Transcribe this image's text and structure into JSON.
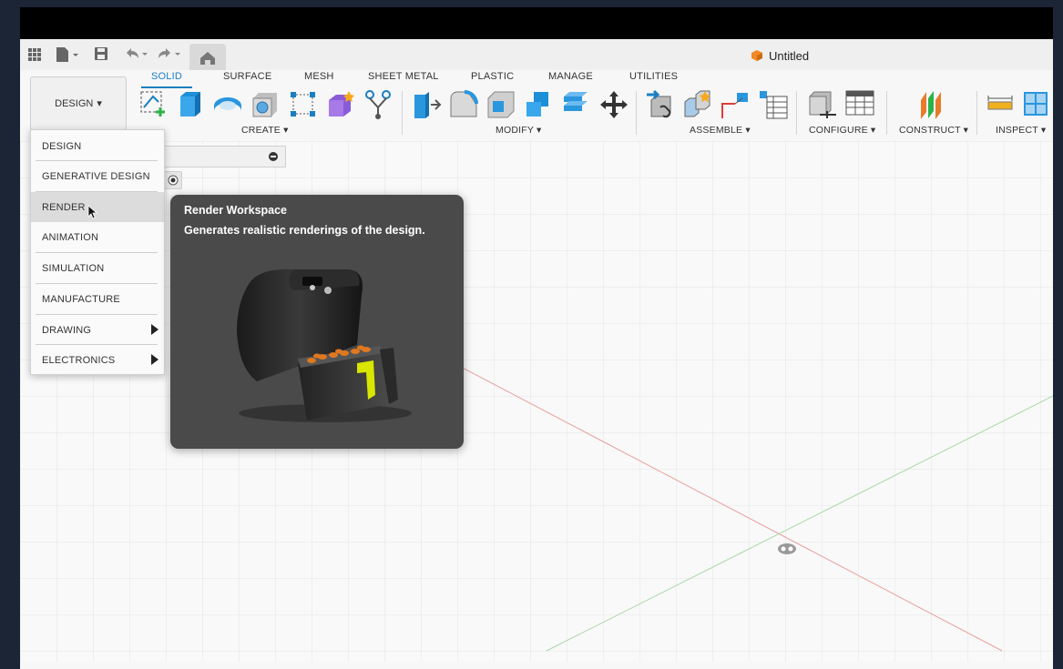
{
  "app": {
    "doc_title": "Untitled"
  },
  "toolbar": {
    "workspace_button": "DESIGN",
    "tabs": [
      "SOLID",
      "SURFACE",
      "MESH",
      "SHEET METAL",
      "PLASTIC",
      "MANAGE",
      "UTILITIES"
    ],
    "active_tab": "SOLID",
    "groups": [
      "CREATE ▾",
      "MODIFY ▾",
      "ASSEMBLE ▾",
      "CONFIGURE ▾",
      "CONSTRUCT ▾",
      "INSPECT ▾"
    ]
  },
  "workspace_menu": {
    "items": [
      "DESIGN",
      "GENERATIVE DESIGN",
      "RENDER",
      "ANIMATION",
      "SIMULATION",
      "MANUFACTURE",
      "DRAWING",
      "ELECTRONICS"
    ],
    "hovered": "RENDER"
  },
  "tooltip": {
    "title": "Render Workspace",
    "description": "Generates realistic renderings of the design."
  },
  "colors": {
    "accent": "#1a7fc1",
    "tooltip_bg": "#4a4a4a"
  }
}
